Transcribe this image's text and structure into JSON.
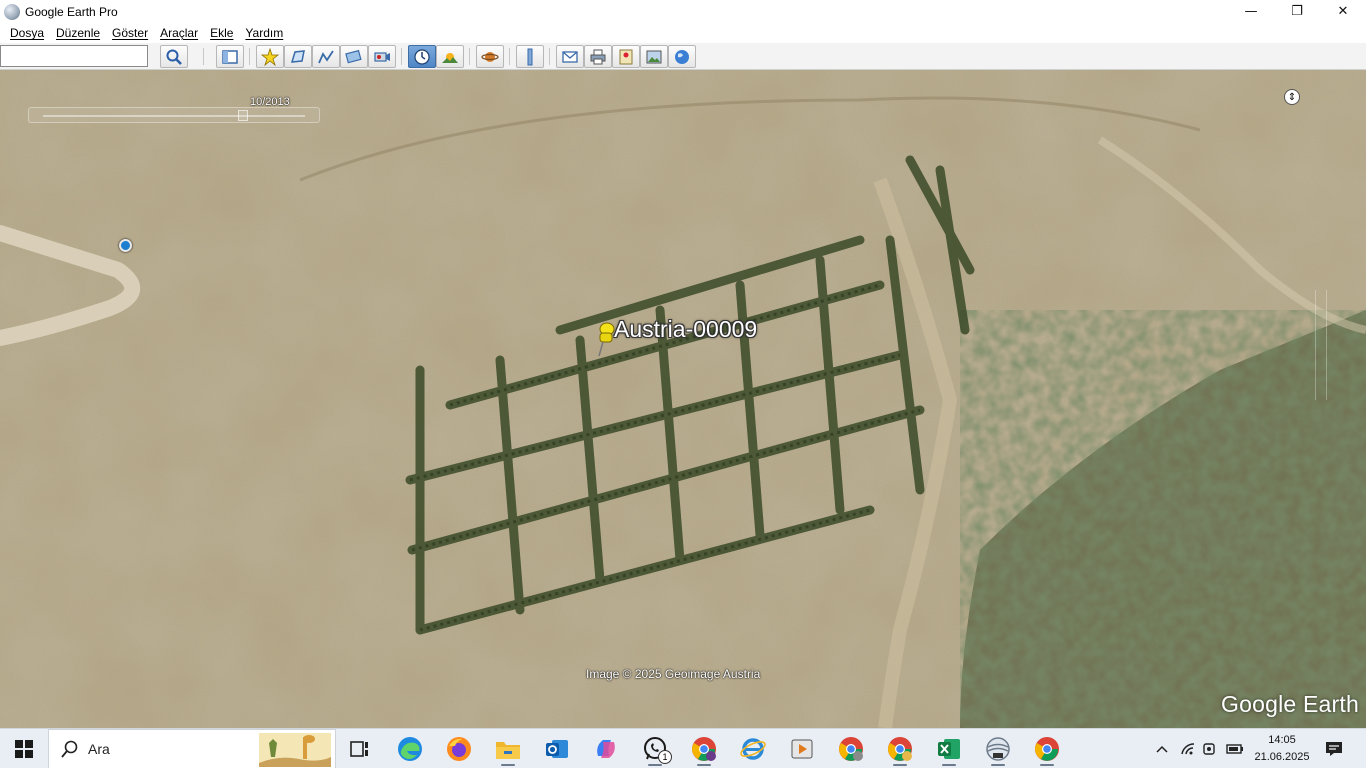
{
  "window": {
    "title": "Google Earth Pro",
    "controls": {
      "minimize": "—",
      "maximize": "❐",
      "close": "✕"
    }
  },
  "menu": {
    "items": [
      {
        "label": "Dosya"
      },
      {
        "label": "Düzenle"
      },
      {
        "label": "Göster"
      },
      {
        "label": "Araçlar"
      },
      {
        "label": "Ekle"
      },
      {
        "label": "Yardım"
      }
    ]
  },
  "toolbar": {
    "search_value": "",
    "buttons": [
      {
        "icon": "search-icon"
      },
      {
        "icon": "sidebar-toggle-icon"
      },
      {
        "icon": "add-placemark-icon"
      },
      {
        "icon": "add-polygon-icon"
      },
      {
        "icon": "add-path-icon"
      },
      {
        "icon": "add-image-overlay-icon"
      },
      {
        "icon": "record-tour-icon"
      },
      {
        "icon": "historical-imagery-icon",
        "active": true
      },
      {
        "icon": "sunlight-icon"
      },
      {
        "icon": "planet-switch-icon"
      },
      {
        "icon": "ruler-icon"
      },
      {
        "icon": "email-icon"
      },
      {
        "icon": "print-icon"
      },
      {
        "icon": "view-in-maps-icon"
      },
      {
        "icon": "save-image-icon"
      },
      {
        "icon": "earth-gallery-icon"
      }
    ]
  },
  "map": {
    "imagery_date": "10/2013",
    "placemark": {
      "label": "Austria-00009",
      "icon": "yellow-pushpin-icon"
    },
    "attribution": "Image © 2025 Geoimage Austria",
    "brand": "Google Earth",
    "north_indicator": "⇕"
  },
  "taskbar": {
    "search_label": "Ara",
    "apps": [
      {
        "name": "task-view",
        "icon": "task-view-icon"
      },
      {
        "name": "edge",
        "icon": "edge-icon"
      },
      {
        "name": "firefox",
        "icon": "firefox-icon"
      },
      {
        "name": "file-explorer",
        "icon": "folder-icon"
      },
      {
        "name": "outlook",
        "icon": "outlook-icon"
      },
      {
        "name": "copilot",
        "icon": "copilot-icon"
      },
      {
        "name": "whatsapp",
        "icon": "whatsapp-icon",
        "badge": "1"
      },
      {
        "name": "chrome-profile-m",
        "icon": "chrome-icon"
      },
      {
        "name": "internet-explorer",
        "icon": "ie-icon"
      },
      {
        "name": "media-player",
        "icon": "video-icon"
      },
      {
        "name": "chrome-profile-2",
        "icon": "chrome-icon"
      },
      {
        "name": "chrome-profile-3",
        "icon": "chrome-icon"
      },
      {
        "name": "excel",
        "icon": "excel-icon"
      },
      {
        "name": "google-earth-pro",
        "icon": "google-earth-icon"
      },
      {
        "name": "chrome",
        "icon": "chrome-icon"
      }
    ],
    "tray": {
      "time": "14:05",
      "date": "21.06.2025"
    }
  }
}
